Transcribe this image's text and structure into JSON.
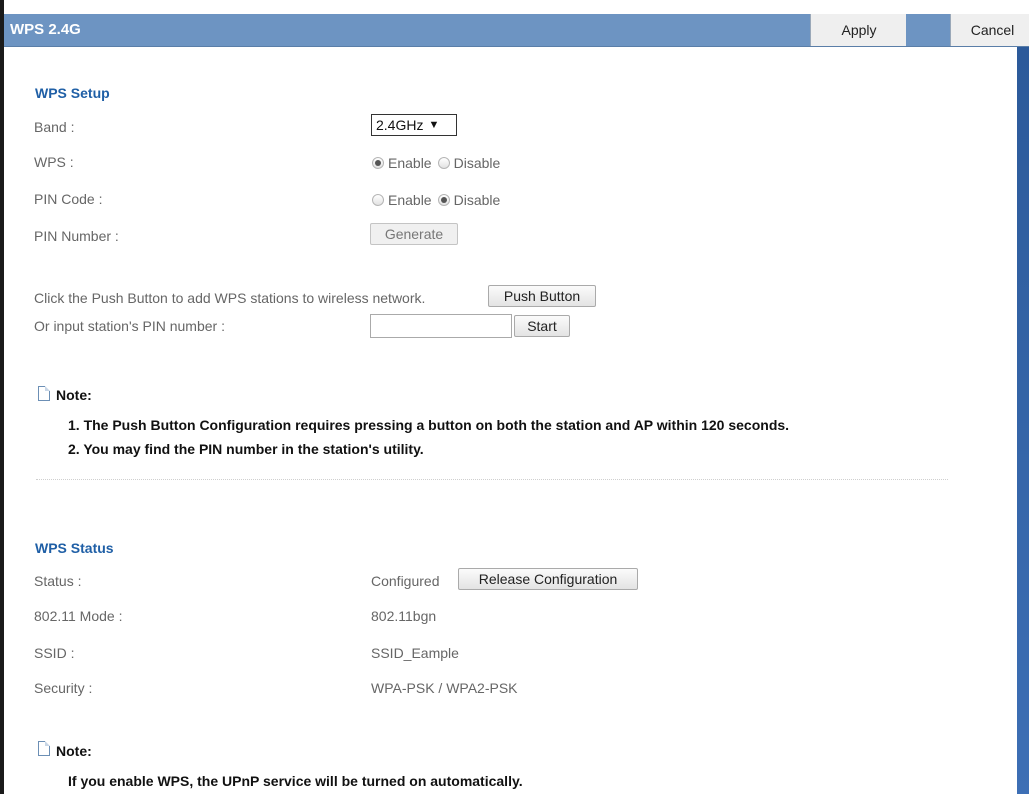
{
  "header": {
    "title": "WPS 2.4G",
    "apply_label": "Apply",
    "cancel_label": "Cancel"
  },
  "setup": {
    "title": "WPS Setup",
    "band_label": "Band :",
    "band_value": "2.4GHz",
    "band_arrow": "▼",
    "wps_label": "WPS :",
    "wps_enable": "Enable",
    "wps_disable": "Disable",
    "wps_selected": "Enable",
    "pin_code_label": "PIN Code :",
    "pin_enable": "Enable",
    "pin_disable": "Disable",
    "pin_selected": "Disable",
    "pin_number_label": "PIN Number :",
    "generate_label": "Generate",
    "push_text": "Click the Push Button to add WPS stations to wireless network.",
    "push_button_label": "Push Button",
    "station_pin_label": "Or input station's PIN number :",
    "station_pin_value": "",
    "start_label": "Start"
  },
  "note1": {
    "title": "Note:",
    "lines": [
      "1. The Push Button Configuration requires pressing a button on both the station and AP within 120 seconds.",
      "2. You may find the PIN number in the station's utility."
    ]
  },
  "status": {
    "title": "WPS Status",
    "status_label": "Status :",
    "status_value": "Configured",
    "release_label": "Release Configuration",
    "mode_label": "802.11 Mode :",
    "mode_value": "802.11bgn",
    "ssid_label": "SSID :",
    "ssid_value": "SSID_Eample",
    "security_label": "Security :",
    "security_value": "WPA-PSK / WPA2-PSK"
  },
  "note2": {
    "title": "Note:",
    "lines": [
      "If you enable WPS, the UPnP service will be turned on automatically."
    ]
  },
  "colors": {
    "header_bg": "#6d94c2",
    "section_title": "#1f5fa6",
    "scrollbar": "#2c5a9a"
  }
}
